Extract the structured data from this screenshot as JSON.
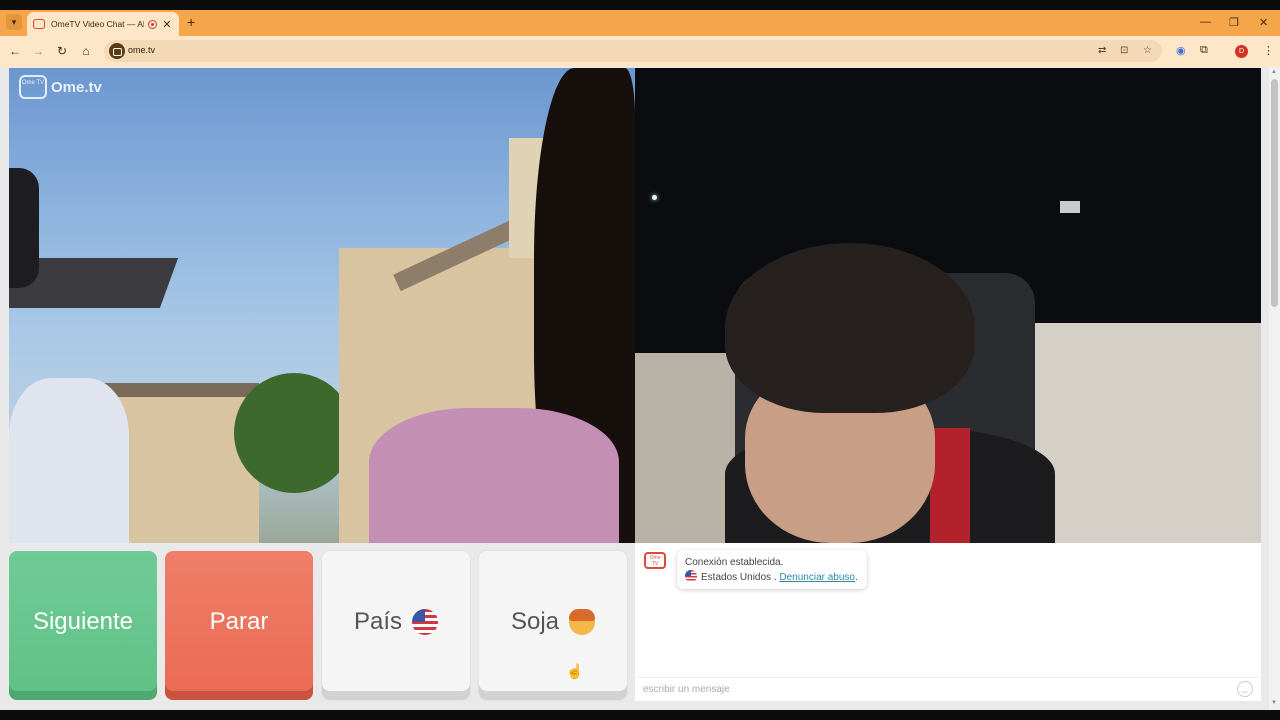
{
  "browser": {
    "tab_title": "OmeTV Video Chat — Alter",
    "url": "ome.tv",
    "new_tab": "+",
    "tab_close": "✕",
    "profile_initial": "D",
    "window_controls": {
      "minimize": "—",
      "restore": "❐",
      "close": "✕"
    },
    "nav": {
      "back": "←",
      "forward": "→",
      "reload": "↻",
      "home": "⌂"
    }
  },
  "logo": {
    "badge": "Ome TV",
    "text": "Ome.tv"
  },
  "controls": {
    "next_label": "Siguiente",
    "stop_label": "Parar",
    "country_label": "País",
    "gender_label": "Soja"
  },
  "chat": {
    "logo_badge": "Ome TV",
    "status": "Conexión establecida.",
    "country": "Estados Unidos",
    "separator": " . ",
    "report_link": "Denunciar abuso",
    "trailing": ".",
    "input_placeholder": "escribir un mensaje"
  },
  "colors": {
    "tabstrip": "#f5a64a",
    "next_button": "#66c58c",
    "stop_button": "#ec7460",
    "link": "#2a8aa8"
  }
}
